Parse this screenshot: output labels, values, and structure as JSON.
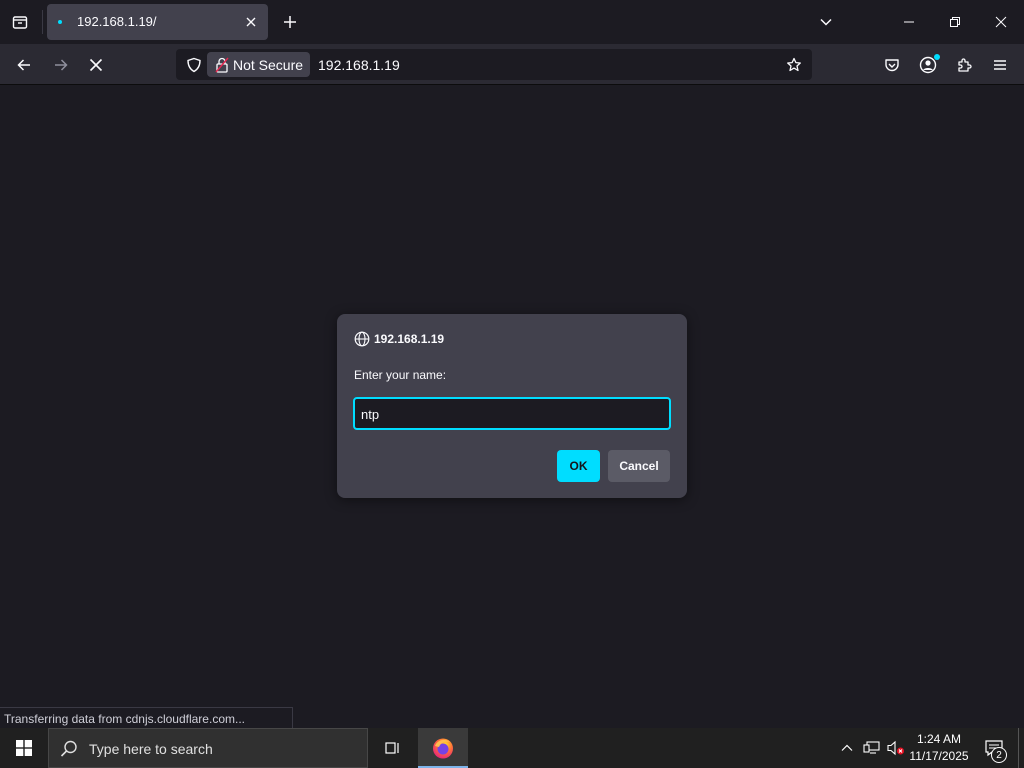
{
  "browser": {
    "tab": {
      "title": "192.168.1.19/",
      "close_icon": "close-icon"
    },
    "urlbar": {
      "security_label": "Not Secure",
      "url": "192.168.1.19"
    },
    "status_text": "Transferring data from cdnjs.cloudflare.com..."
  },
  "dialog": {
    "origin": "192.168.1.19",
    "message": "Enter your name:",
    "input_value": "ntp",
    "ok_label": "OK",
    "cancel_label": "Cancel"
  },
  "taskbar": {
    "search_placeholder": "Type here to search",
    "clock_time": "1:24 AM",
    "clock_date": "11/17/2025",
    "notification_count": "2"
  },
  "colors": {
    "accent": "#00ddff",
    "chrome_bg": "#1c1b22",
    "toolbar_bg": "#2b2a33",
    "dialog_bg": "#42414d"
  }
}
